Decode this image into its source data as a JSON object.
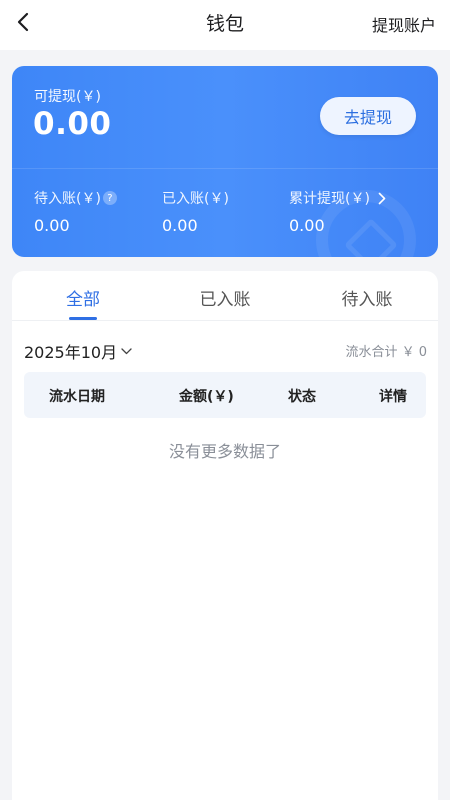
{
  "nav": {
    "title": "钱包",
    "right_action": "提现账户",
    "back_icon": "chevron-left-icon"
  },
  "card": {
    "available_label": "可提现(￥)",
    "available_amount": "0.00",
    "withdraw_button": "去提现",
    "stats": [
      {
        "label": "待入账(￥)",
        "value": "0.00",
        "icon": "question-icon"
      },
      {
        "label": "已入账(￥)",
        "value": "0.00"
      },
      {
        "label": "累计提现(￥)",
        "value": "0.00",
        "icon": "chevron-right-icon"
      }
    ],
    "colors": {
      "gradient_start": "#3e86f7",
      "gradient_end": "#3f82f5",
      "button_text": "#2c6fe0"
    }
  },
  "tabs": [
    {
      "label": "全部",
      "active": true
    },
    {
      "label": "已入账",
      "active": false
    },
    {
      "label": "待入账",
      "active": false
    }
  ],
  "filter": {
    "month": "2025年10月",
    "total": "流水合计 ￥ 0"
  },
  "table": {
    "headers": [
      "流水日期",
      "金额(￥)",
      "状态",
      "详情"
    ]
  },
  "empty_message": "没有更多数据了",
  "accent_color": "#2f6fe4"
}
